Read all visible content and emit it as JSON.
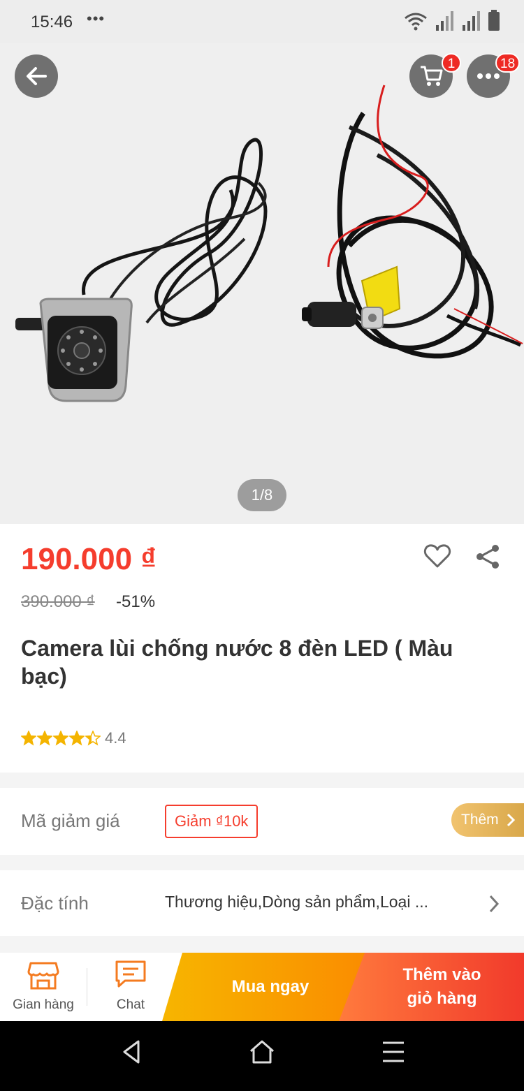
{
  "status_bar": {
    "time": "15:46",
    "dots": "•••"
  },
  "gallery": {
    "pager": "1/8",
    "cart_badge": "1",
    "more_badge": "18"
  },
  "product": {
    "price": "190.000 ₫",
    "old_price": "390.000 ₫",
    "discount": "-51%",
    "title": "Camera lùi chống nước 8 đèn LED ( Màu bạc)",
    "rating": "4.4",
    "stars_filled": 4.4,
    "stars_total": 5
  },
  "voucher": {
    "label": "Mã giảm giá",
    "tag": "Giảm ₫10k",
    "more": "Thêm"
  },
  "specs": {
    "label": "Đặc tính",
    "value": "Thương hiệu,Dòng sản phẩm,Loại ..."
  },
  "actions": {
    "shop_label": "Gian hàng",
    "chat_label": "Chat",
    "buy_now": "Mua ngay",
    "add_cart_line1": "Thêm vào",
    "add_cart_line2": "giỏ hàng"
  },
  "colors": {
    "accent": "#f53d2d",
    "star": "#f4b400",
    "buy_now": "#f7b500",
    "add_cart": "#f13a2b"
  }
}
